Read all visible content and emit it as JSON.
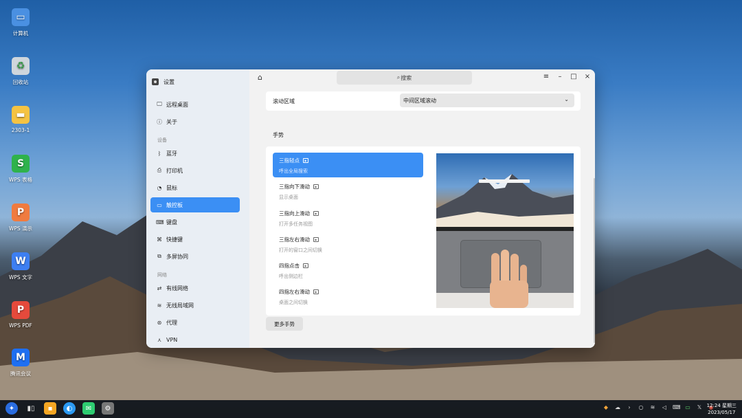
{
  "desktop": {
    "icons": [
      {
        "label": "计算机",
        "icon": "monitor-icon",
        "color": "#4a90e2"
      },
      {
        "label": "回收站",
        "icon": "trash-icon",
        "color": "#cfd6dc"
      },
      {
        "label": "2303-1",
        "icon": "folder-icon",
        "color": "#f5c342"
      },
      {
        "label": "WPS 表格",
        "icon": "wps-sheet-icon",
        "color": "#2fb24c"
      },
      {
        "label": "WPS 演示",
        "icon": "wps-slides-icon",
        "color": "#f07b3f"
      },
      {
        "label": "WPS 文字",
        "icon": "wps-writer-icon",
        "color": "#3d7ff2"
      },
      {
        "label": "WPS PDF",
        "icon": "wps-pdf-icon",
        "color": "#e54a3c"
      },
      {
        "label": "腾讯会议",
        "icon": "tencent-meeting-icon",
        "color": "#1e6ff2"
      }
    ]
  },
  "window": {
    "title": "设置",
    "search_placeholder": "搜索",
    "controls": {
      "menu": "≡",
      "minimize": "–",
      "maximize": "□",
      "close": "×"
    }
  },
  "sidebar": {
    "top_items": [
      {
        "label": "远程桌面",
        "icon": "remote-desktop-icon",
        "glyph": "🖵"
      },
      {
        "label": "关于",
        "icon": "info-icon",
        "glyph": "ⓘ"
      }
    ],
    "group_device": "设备",
    "device_items": [
      {
        "label": "蓝牙",
        "icon": "bluetooth-icon",
        "glyph": "ᛒ"
      },
      {
        "label": "打印机",
        "icon": "printer-icon",
        "glyph": "⎙"
      },
      {
        "label": "鼠标",
        "icon": "mouse-icon",
        "glyph": "◔"
      },
      {
        "label": "触控板",
        "icon": "touchpad-icon",
        "glyph": "▭"
      },
      {
        "label": "键盘",
        "icon": "keyboard-icon",
        "glyph": "⌨"
      },
      {
        "label": "快捷键",
        "icon": "shortcut-icon",
        "glyph": "⌘"
      },
      {
        "label": "多屏协同",
        "icon": "multiscreen-icon",
        "glyph": "⧉"
      }
    ],
    "group_network": "网络",
    "network_items": [
      {
        "label": "有线网络",
        "icon": "wired-network-icon",
        "glyph": "⇄"
      },
      {
        "label": "无线局域网",
        "icon": "wifi-icon",
        "glyph": "≋"
      },
      {
        "label": "代理",
        "icon": "proxy-icon",
        "glyph": "⊛"
      },
      {
        "label": "VPN",
        "icon": "vpn-icon",
        "glyph": "⋏"
      }
    ],
    "active": "触控板"
  },
  "settings": {
    "scroll_area_label": "滚动区域",
    "scroll_area_value": "中间区域滚动",
    "gesture_section_title": "手势",
    "gestures": [
      {
        "title": "三指轻点",
        "desc": "呼出全局搜索",
        "active": true
      },
      {
        "title": "三指向下滑动",
        "desc": "显示桌面",
        "active": false
      },
      {
        "title": "三指向上滑动",
        "desc": "打开多任务视图",
        "active": false
      },
      {
        "title": "三指左右滑动",
        "desc": "打开的窗口之间切换",
        "active": false
      },
      {
        "title": "四指点击",
        "desc": "呼出侧边栏",
        "active": false
      },
      {
        "title": "四指左右滑动",
        "desc": "桌面之间切换",
        "active": false
      }
    ],
    "more_gestures_label": "更多手势"
  },
  "taskbar": {
    "apps": [
      {
        "icon": "start-menu-icon",
        "color": "#2a6de0"
      },
      {
        "icon": "multitask-view-icon",
        "color": "#555555"
      },
      {
        "icon": "file-manager-icon",
        "color": "#f5a623"
      },
      {
        "icon": "browser-icon",
        "color": "#2b9af3"
      },
      {
        "icon": "messenger-icon",
        "color": "#2ecc71"
      },
      {
        "icon": "settings-app-icon",
        "color": "#777777"
      }
    ],
    "tray": [
      "color-picker-icon",
      "cloud-icon",
      "chevron-right-icon",
      "search-icon",
      "wifi-icon",
      "volume-icon",
      "keyboard-icon",
      "battery-icon",
      "x-icon",
      "notification-icon"
    ],
    "time": "12:24 星期三",
    "date": "2023/05/17"
  }
}
